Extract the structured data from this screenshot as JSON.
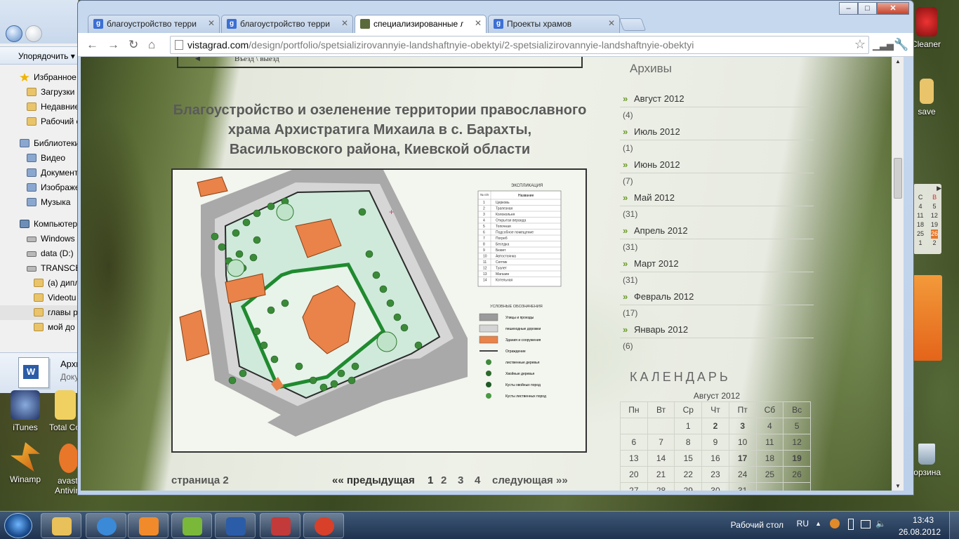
{
  "explorer": {
    "toolbar": "Упорядочить",
    "items": [
      {
        "label": "Избранное",
        "icon": "star-icon",
        "level": 1
      },
      {
        "label": "Загрузки",
        "icon": "folder-icon",
        "level": 2
      },
      {
        "label": "Недавние места",
        "icon": "folder-icon",
        "level": 2
      },
      {
        "label": "Рабочий стол",
        "icon": "folder-icon",
        "level": 2
      },
      {
        "label": "Библиотеки",
        "icon": "library-icon",
        "level": 1
      },
      {
        "label": "Видео",
        "icon": "library-icon",
        "level": 2
      },
      {
        "label": "Документы",
        "icon": "library-icon",
        "level": 2
      },
      {
        "label": "Изображения",
        "icon": "library-icon",
        "level": 2
      },
      {
        "label": "Музыка",
        "icon": "library-icon",
        "level": 2
      },
      {
        "label": "Компьютер",
        "icon": "computer-icon",
        "level": 1
      },
      {
        "label": "Windows",
        "icon": "drive-icon",
        "level": 2
      },
      {
        "label": "data (D:)",
        "icon": "drive-icon",
        "level": 2
      },
      {
        "label": "TRANSCEND",
        "icon": "drive-icon",
        "level": 2
      },
      {
        "label": "(а) дипл",
        "icon": "folder-icon",
        "level": 3
      },
      {
        "label": "Videotu",
        "icon": "folder-icon",
        "level": 3
      },
      {
        "label": "главы р",
        "icon": "folder-icon",
        "level": 3
      },
      {
        "label": "мой до",
        "icon": "folder-icon",
        "level": 3
      }
    ],
    "footer_title": "Архитектура",
    "footer_sub": "Документ"
  },
  "desktop_icons": [
    {
      "label": "iTunes"
    },
    {
      "label": "Total Commander"
    },
    {
      "label": "Winamp"
    },
    {
      "label": "avast! Antivirus"
    }
  ],
  "desktop_right": {
    "ccleaner": "CCleaner",
    "save": "save",
    "recycle": "Корзина"
  },
  "gadget_calendar": {
    "rows": [
      [
        "С",
        "В"
      ],
      [
        "4",
        "5"
      ],
      [
        "11",
        "12"
      ],
      [
        "18",
        "19"
      ],
      [
        "25",
        "26"
      ],
      [
        "1",
        "2"
      ]
    ]
  },
  "browser": {
    "tabs": [
      {
        "label": "благоустройство террито",
        "fav": "g"
      },
      {
        "label": "благоустройство террито",
        "fav": "g"
      },
      {
        "label": "специализированные лан",
        "fav": "img",
        "active": true
      },
      {
        "label": "Проекты храмов",
        "fav": "g"
      }
    ],
    "url_domain": "vistagrad.com",
    "url_path": "/design/portfolio/spetsializirovannyie-landshaftnyie-obektyi/2-spetsializirovannyie-landshaftnyie-obektyi"
  },
  "page": {
    "entry_label": "Въезд \\ выезд",
    "title": "Благоустройство и озеленение территории православного храма Архистратига Михаила в с. Барахты, Васильковского района, Киевской области",
    "plan": {
      "explication_title": "ЭКСПЛИКАЦИЯ",
      "explication_cols": [
        "№ п/п",
        "Название"
      ],
      "explication": [
        [
          "1",
          "Церковь"
        ],
        [
          "2",
          "Трапезная"
        ],
        [
          "3",
          "Колокольня"
        ],
        [
          "4",
          "Открытая веранда"
        ],
        [
          "5",
          "Топочная"
        ],
        [
          "6",
          "Подсобное помещение"
        ],
        [
          "7",
          "Погреб"
        ],
        [
          "8",
          "Беседка"
        ],
        [
          "9",
          "Бювет"
        ],
        [
          "10",
          "Автостоянка"
        ],
        [
          "11",
          "Септик"
        ],
        [
          "12",
          "Туалет"
        ],
        [
          "13",
          "Магазин"
        ],
        [
          "14",
          "Котельная"
        ]
      ],
      "legend_title": "УСЛОВНЫЕ ОБОЗНАЧЕНИЯ",
      "legend": [
        {
          "label": "Улицы и проезды",
          "color": "#9a9a9a"
        },
        {
          "label": "пешеходные дорожки",
          "color": "#d4d4d4"
        },
        {
          "label": "Здания и сооружения",
          "color": "#e9834a"
        },
        {
          "label": "Ограждение",
          "color": "#444444"
        },
        {
          "label": "лиственные деревья",
          "color": "#3e8a3a"
        },
        {
          "label": "Хвойные деревья",
          "color": "#2b6a2b"
        },
        {
          "label": "Кусты хвойных пород",
          "color": "#1f5a25"
        },
        {
          "label": "Кусты лиственных пород",
          "color": "#4a9a44"
        }
      ]
    },
    "pagination": {
      "current": "страница 2",
      "prev": "«« предыдущая",
      "pages": [
        "1",
        "2",
        "3",
        "4"
      ],
      "next": "следующая »»"
    },
    "archives_title": "Архивы",
    "archives": [
      {
        "m": "Август 2012",
        "c": "(4)"
      },
      {
        "m": "Июль 2012",
        "c": "(1)"
      },
      {
        "m": "Июнь 2012",
        "c": "(7)"
      },
      {
        "m": "Май 2012",
        "c": "(31)"
      },
      {
        "m": "Апрель 2012",
        "c": "(31)"
      },
      {
        "m": "Март 2012",
        "c": "(31)"
      },
      {
        "m": "Февраль 2012",
        "c": "(17)"
      },
      {
        "m": "Январь 2012",
        "c": "(6)"
      }
    ],
    "calendar_title": "КАЛЕНДАРЬ",
    "calendar": {
      "caption": "Август 2012",
      "days": [
        "Пн",
        "Вт",
        "Ср",
        "Чт",
        "Пт",
        "Сб",
        "Вс"
      ],
      "weeks": [
        [
          "",
          "",
          "1",
          "2",
          "3",
          "4",
          "5"
        ],
        [
          "6",
          "7",
          "8",
          "9",
          "10",
          "11",
          "12"
        ],
        [
          "13",
          "14",
          "15",
          "16",
          "17",
          "18",
          "19"
        ],
        [
          "20",
          "21",
          "22",
          "23",
          "24",
          "25",
          "26"
        ],
        [
          "27",
          "28",
          "29",
          "30",
          "31",
          "",
          ""
        ]
      ],
      "bold": [
        "2",
        "3",
        "17",
        "19"
      ]
    }
  },
  "taskbar": {
    "apps": [
      {
        "name": "explorer-icon",
        "color": "#e8c15a"
      },
      {
        "name": "ie-icon",
        "color": "#3a8ad8"
      },
      {
        "name": "media-player-icon",
        "color": "#f08a2a"
      },
      {
        "name": "picasa-icon",
        "color": "#7ab83a"
      },
      {
        "name": "word-icon",
        "color": "#2b5ca8"
      },
      {
        "name": "audio-app-icon",
        "color": "#c23a3a"
      },
      {
        "name": "chrome-icon",
        "color": "#d8402a"
      }
    ],
    "desktop_label": "Рабочий стол",
    "lang": "RU",
    "time": "13:43",
    "date": "26.08.2012"
  }
}
